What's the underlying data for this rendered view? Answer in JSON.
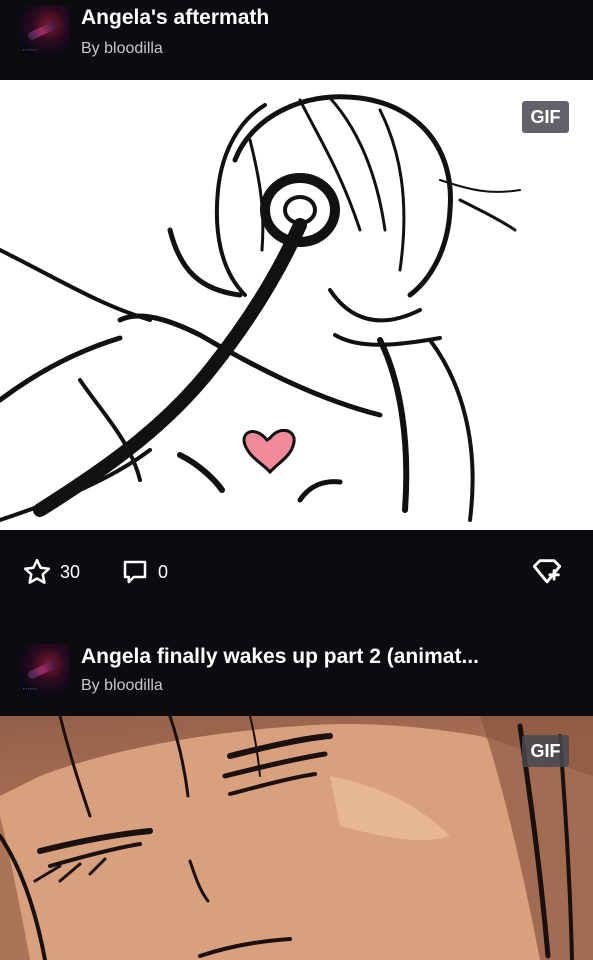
{
  "posts": [
    {
      "title": "Angela's aftermath",
      "author": "By bloodilla",
      "badge": "GIF",
      "likes": "30",
      "comments": "0"
    },
    {
      "title": "Angela finally wakes up part 2 (animat...",
      "author": "By bloodilla",
      "badge": "GIF"
    }
  ],
  "icons": {
    "like": "star-icon",
    "comment": "comment-bubble-icon",
    "gift": "gift-tag-icon"
  },
  "colors": {
    "background": "#0c0c10",
    "text": "#ffffff",
    "subtext": "#c8c8cc",
    "badge": "#46484f",
    "heart": "#f08b9a"
  }
}
